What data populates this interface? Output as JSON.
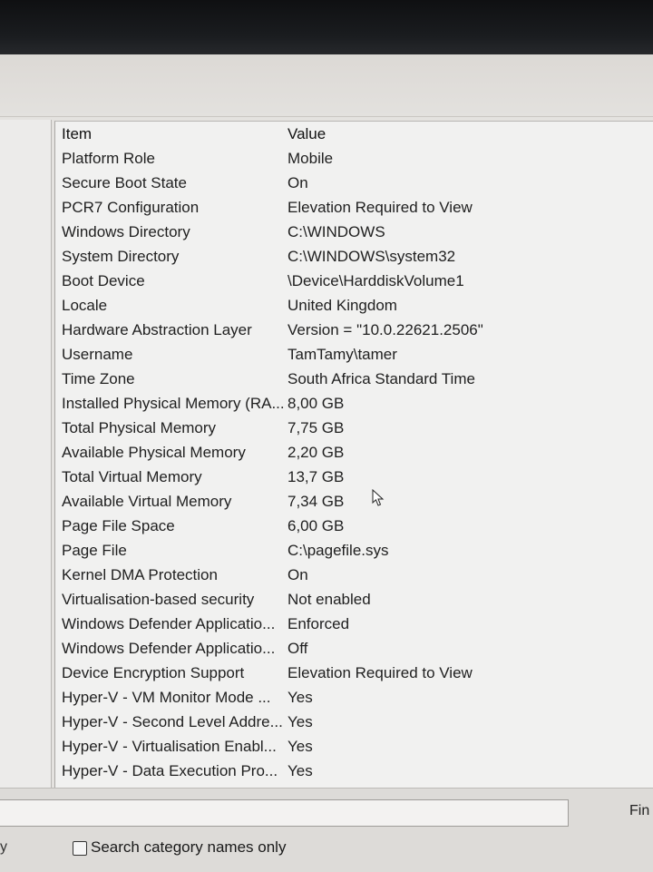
{
  "table": {
    "header": {
      "item": "Item",
      "value": "Value"
    },
    "rows": [
      {
        "item": "Platform Role",
        "value": "Mobile"
      },
      {
        "item": "Secure Boot State",
        "value": "On"
      },
      {
        "item": "PCR7 Configuration",
        "value": "Elevation Required to View"
      },
      {
        "item": "Windows Directory",
        "value": "C:\\WINDOWS"
      },
      {
        "item": "System Directory",
        "value": "C:\\WINDOWS\\system32"
      },
      {
        "item": "Boot Device",
        "value": "\\Device\\HarddiskVolume1"
      },
      {
        "item": "Locale",
        "value": "United Kingdom"
      },
      {
        "item": "Hardware Abstraction Layer",
        "value": "Version = \"10.0.22621.2506\""
      },
      {
        "item": "Username",
        "value": "TamTamy\\tamer"
      },
      {
        "item": "Time Zone",
        "value": "South Africa Standard Time"
      },
      {
        "item": "Installed Physical Memory (RA...",
        "value": "8,00 GB"
      },
      {
        "item": "Total Physical Memory",
        "value": "7,75 GB"
      },
      {
        "item": "Available Physical Memory",
        "value": "2,20 GB"
      },
      {
        "item": "Total Virtual Memory",
        "value": "13,7 GB"
      },
      {
        "item": "Available Virtual Memory",
        "value": "7,34 GB"
      },
      {
        "item": "Page File Space",
        "value": "6,00 GB"
      },
      {
        "item": "Page File",
        "value": "C:\\pagefile.sys"
      },
      {
        "item": "Kernel DMA Protection",
        "value": "On"
      },
      {
        "item": "Virtualisation-based security",
        "value": "Not enabled"
      },
      {
        "item": "Windows Defender Applicatio...",
        "value": "Enforced"
      },
      {
        "item": "Windows Defender Applicatio...",
        "value": "Off"
      },
      {
        "item": "Device Encryption Support",
        "value": "Elevation Required to View"
      },
      {
        "item": "Hyper-V - VM Monitor Mode ...",
        "value": "Yes"
      },
      {
        "item": "Hyper-V - Second Level Addre...",
        "value": "Yes"
      },
      {
        "item": "Hyper-V - Virtualisation Enabl...",
        "value": "Yes"
      },
      {
        "item": "Hyper-V - Data Execution Pro...",
        "value": "Yes"
      }
    ]
  },
  "bottom": {
    "find_label": "Fin",
    "sidebar_fragment": "y",
    "search_category_label": "Search category names only"
  }
}
